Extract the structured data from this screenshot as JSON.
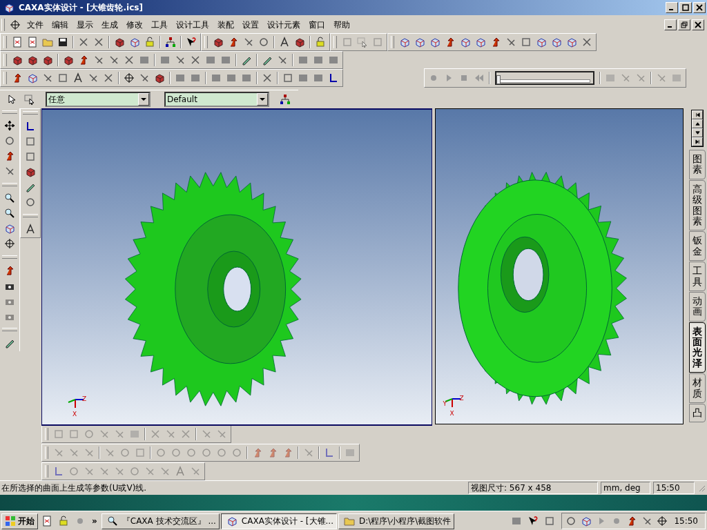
{
  "window": {
    "title": "CAXA实体设计 - [大锥齿轮.ics]"
  },
  "menu": [
    "文件",
    "编辑",
    "显示",
    "生成",
    "修改",
    "工具",
    "设计工具",
    "装配",
    "设置",
    "设计元素",
    "窗口",
    "帮助"
  ],
  "selection_bar": {
    "filter": "任意",
    "style": "Default"
  },
  "animation_bar": {
    "slider": {
      "level": 0
    }
  },
  "viewports": [
    {
      "axes": [
        "Z",
        "X"
      ]
    },
    {
      "axes": [
        "Y",
        "Z",
        "X"
      ]
    }
  ],
  "side_tabs": [
    {
      "label": "图素",
      "selected": false
    },
    {
      "label": "高级图素",
      "selected": false
    },
    {
      "label": "钣金",
      "selected": false
    },
    {
      "label": "工具",
      "selected": false
    },
    {
      "label": "动画",
      "selected": false
    },
    {
      "label": "表面光泽",
      "selected": true
    },
    {
      "label": "材质",
      "selected": false
    },
    {
      "label": "凸",
      "selected": false
    }
  ],
  "status_bar": {
    "message": "在所选择的曲面上生成等参数(U或V)线.",
    "view_size": "视图尺寸: 567 x 458",
    "units": "mm, deg",
    "time": "15:50"
  },
  "taskbar": {
    "start": "开始",
    "more": "»",
    "tasks": [
      {
        "label": "『CAXA 技术交流区』 ...",
        "selected": false
      },
      {
        "label": "CAXA实体设计 - [大锥...",
        "selected": true
      },
      {
        "label": "D:\\程序\\小程序\\截图软件",
        "selected": false
      }
    ],
    "clock": "15:50"
  }
}
